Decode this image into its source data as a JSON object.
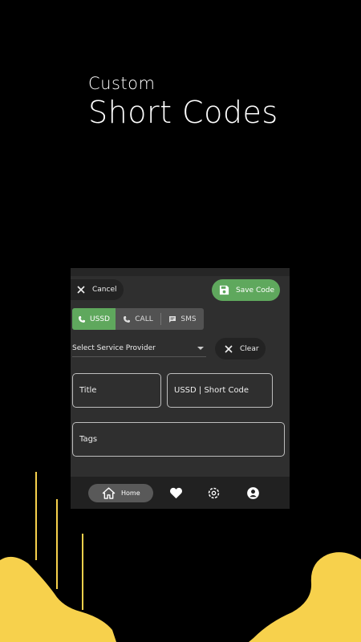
{
  "headline": {
    "subtitle": "Custom",
    "title": "Short Codes"
  },
  "toolbar": {
    "cancel_label": "Cancel",
    "save_label": "Save Code"
  },
  "segments": {
    "ussd": "USSD",
    "call": "CALL",
    "sms": "SMS",
    "selected": "USSD"
  },
  "provider": {
    "label": "Select Service Provider"
  },
  "clear": {
    "label": "Clear"
  },
  "fields": {
    "title": "Title",
    "code": "USSD | Short Code",
    "tags": "Tags"
  },
  "nav": {
    "home": "Home"
  },
  "colors": {
    "accent": "#5fa85d",
    "decor_yellow": "#f7d14c",
    "background": "#000000",
    "panel": "#2f2f2f"
  },
  "icons": {
    "cancel": "close-icon",
    "save": "save-icon",
    "ussd": "phone-icon",
    "call": "phone-icon",
    "sms": "message-icon",
    "dropdown": "chevron-down-icon",
    "clear": "close-icon",
    "home": "home-icon",
    "favorites": "heart-icon",
    "settings": "gear-icon",
    "account": "user-icon"
  }
}
